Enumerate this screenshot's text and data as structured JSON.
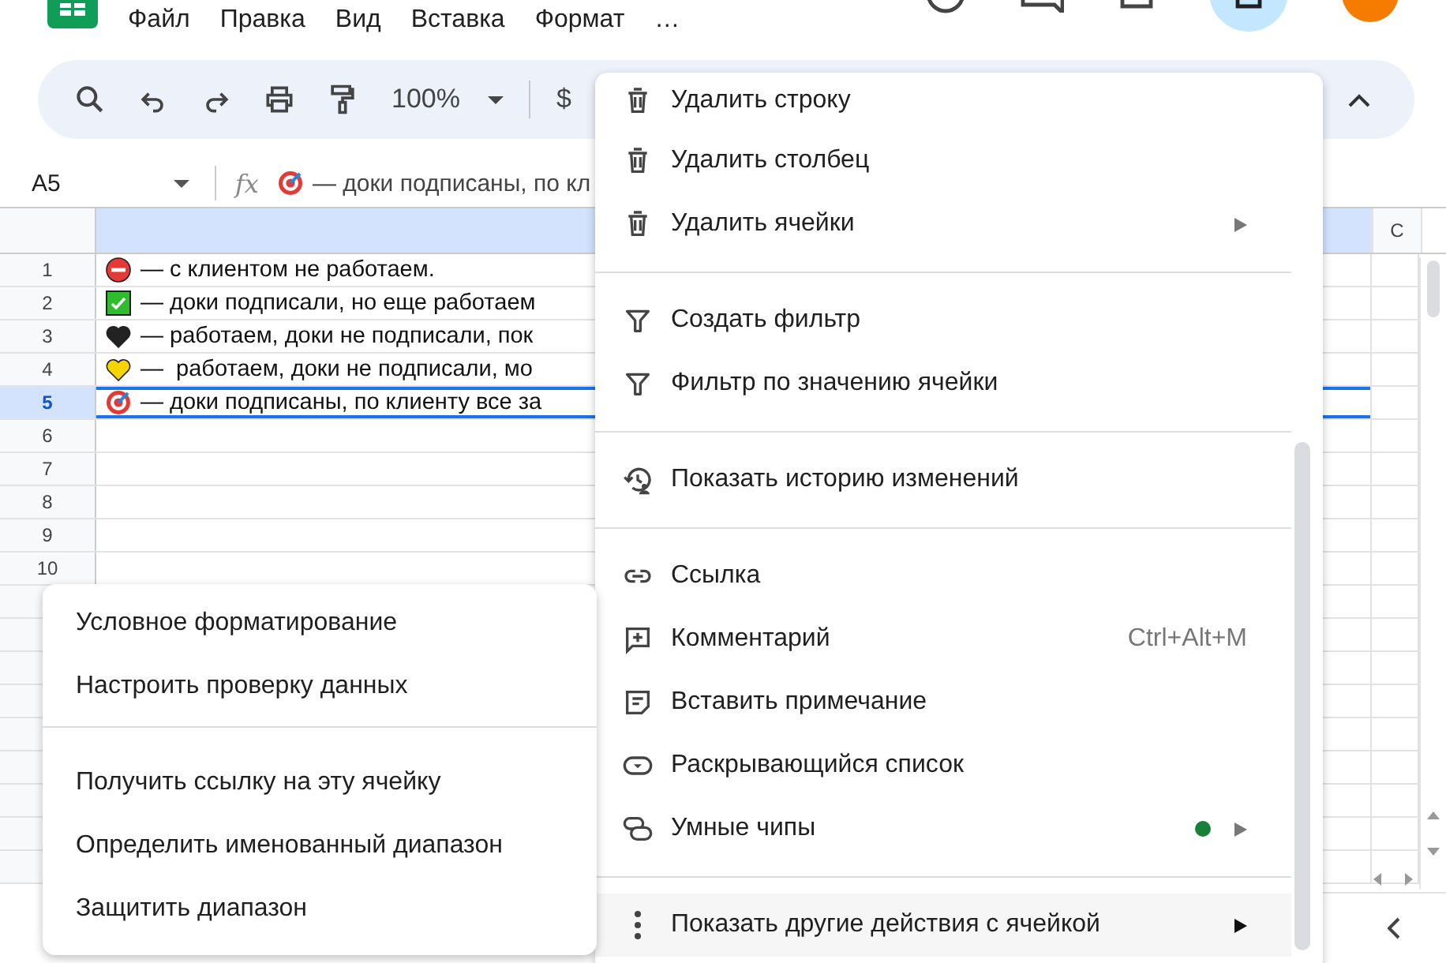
{
  "app_menu": [
    "Файл",
    "Правка",
    "Вид",
    "Вставка",
    "Формат",
    "…"
  ],
  "toolbar": {
    "zoom": "100%",
    "currency": "$"
  },
  "formula_bar": {
    "cell_ref": "A5",
    "fx": "fx",
    "kind": "target",
    "value": "— доки подписаны, по кл"
  },
  "sheet": {
    "column_c": "C",
    "rows": [
      {
        "number": "1",
        "kind": "no_entry",
        "text": "— с клиентом не работаем.",
        "selected": false
      },
      {
        "number": "2",
        "kind": "check",
        "text": "— доки подписали, но еще работаем",
        "selected": false
      },
      {
        "number": "3",
        "kind": "black_heart",
        "text": "— работаем, доки не подписали, пок",
        "selected": false
      },
      {
        "number": "4",
        "kind": "yellow_heart",
        "text": "—  работаем, доки не подписали, мо",
        "selected": false
      },
      {
        "number": "5",
        "kind": "target",
        "text": "— доки подписаны, по клиенту все за",
        "selected": true
      },
      {
        "number": "6",
        "kind": "empty",
        "selected": false
      },
      {
        "number": "7",
        "kind": "empty",
        "selected": false
      },
      {
        "number": "8",
        "kind": "empty",
        "selected": false
      },
      {
        "number": "9",
        "kind": "empty",
        "selected": false
      },
      {
        "number": "10",
        "kind": "empty",
        "selected": false
      }
    ]
  },
  "context_menu": {
    "items": [
      {
        "kind": "trash",
        "label": "Удалить строку",
        "submenu": false,
        "highlighted": false
      },
      {
        "kind": "trash",
        "label": "Удалить столбец",
        "submenu": false,
        "highlighted": false
      },
      {
        "kind": "trash",
        "label": "Удалить ячейки",
        "submenu": true,
        "highlighted": false
      },
      {
        "kind": "divider"
      },
      {
        "kind": "filter",
        "label": "Создать фильтр",
        "submenu": false,
        "highlighted": false
      },
      {
        "kind": "filter",
        "label": "Фильтр по значению ячейки",
        "submenu": false,
        "highlighted": false
      },
      {
        "kind": "divider"
      },
      {
        "kind": "history",
        "label": "Показать историю изменений",
        "submenu": false,
        "highlighted": false
      },
      {
        "kind": "divider"
      },
      {
        "kind": "link",
        "label": "Ссылка",
        "submenu": false,
        "highlighted": false
      },
      {
        "kind": "comment",
        "label": "Комментарий",
        "shortcut": "Ctrl+Alt+M",
        "submenu": false,
        "highlighted": false
      },
      {
        "kind": "note",
        "label": "Вставить примечание",
        "submenu": false,
        "highlighted": false
      },
      {
        "kind": "dropdown",
        "label": "Раскрывающийся список",
        "submenu": false,
        "highlighted": false
      },
      {
        "kind": "chips",
        "label": "Умные чипы",
        "dot": true,
        "submenu": true,
        "highlighted": false
      },
      {
        "kind": "divider"
      },
      {
        "kind": "more",
        "label": "Показать другие действия с ячейкой",
        "submenu": true,
        "highlighted": true
      }
    ]
  },
  "cell_menu": {
    "items": [
      {
        "kind": "item",
        "label": "Условное форматирование"
      },
      {
        "kind": "item",
        "label": "Настроить проверку данных"
      },
      {
        "kind": "divider"
      },
      {
        "kind": "item",
        "label": "Получить ссылку на эту ячейку"
      },
      {
        "kind": "item",
        "label": "Определить именованный диапазон"
      },
      {
        "kind": "item",
        "label": "Защитить диапазон"
      }
    ]
  }
}
